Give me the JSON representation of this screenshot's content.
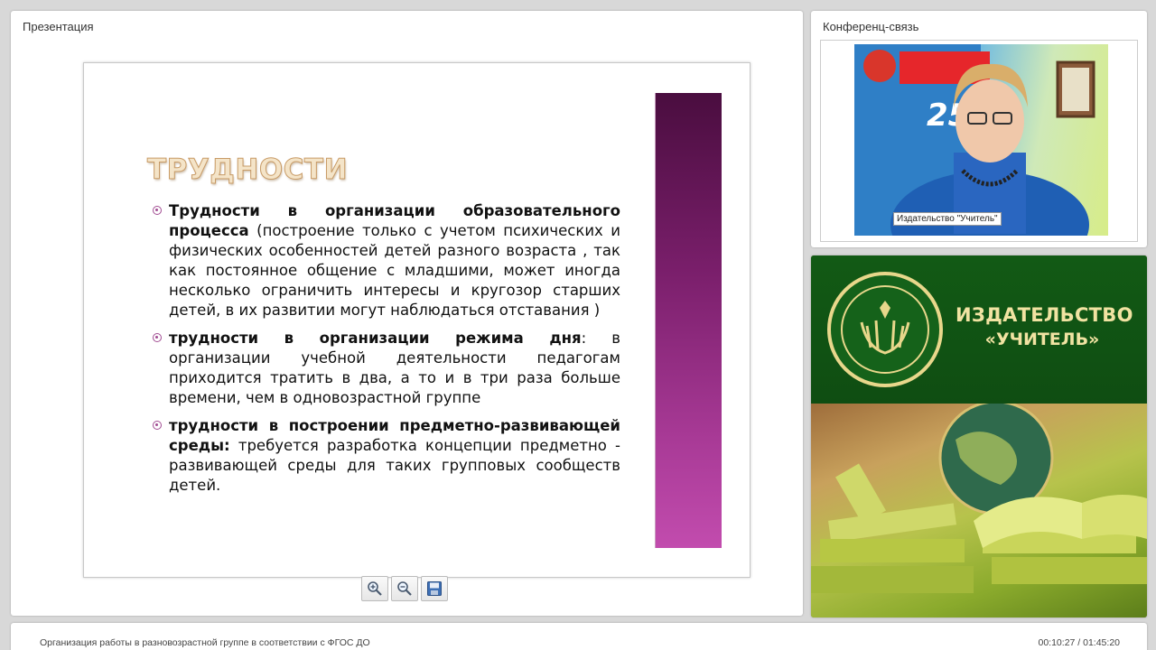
{
  "presentation": {
    "panel_title": "Презентация",
    "slide": {
      "title": "ТРУДНОСТИ",
      "bullets": [
        {
          "bold": "Трудности в организации образовательного процесса",
          "text": " (построение только с учетом психических и физических особенностей детей разного возраста , так как постоянное общение с младшими, может иногда несколько ограничить интересы и кругозор старших детей, в их развитии могут наблюдаться отставания )"
        },
        {
          "bold": "трудности в организации режима дня",
          "text": ": в организации учебной деятельности педагогам приходится тратить в два, а то и в три раза больше времени, чем в одновозрастной группе"
        },
        {
          "bold": "трудности в построении предметно-развивающей среды:",
          "text": " требуется разработка концепции предметно - развивающей среды для таких групповых сообществ детей."
        }
      ]
    },
    "toolbar": {
      "zoom_in_icon": "zoom-in-icon",
      "zoom_out_icon": "zoom-out-icon",
      "save_icon": "save-icon"
    },
    "colors": {
      "accent_bar_top": "#4a0d3f",
      "accent_bar_bottom": "#c24cae",
      "bullet": "#a24d93"
    }
  },
  "conference": {
    "panel_title": "Конференц-связь",
    "video_caption": "Издательство \"Учитель\""
  },
  "ad": {
    "line1": "ИЗДАТЕЛЬСТВО",
    "line2": "«УЧИТЕЛЬ»",
    "colors": {
      "green": "#125a15",
      "gold": "#e8d78b"
    }
  },
  "footer": {
    "title": "Организация работы в разновозрастной группе  в соответствии с ФГОС ДО",
    "time": "00:10:27 / 01:45:20"
  }
}
